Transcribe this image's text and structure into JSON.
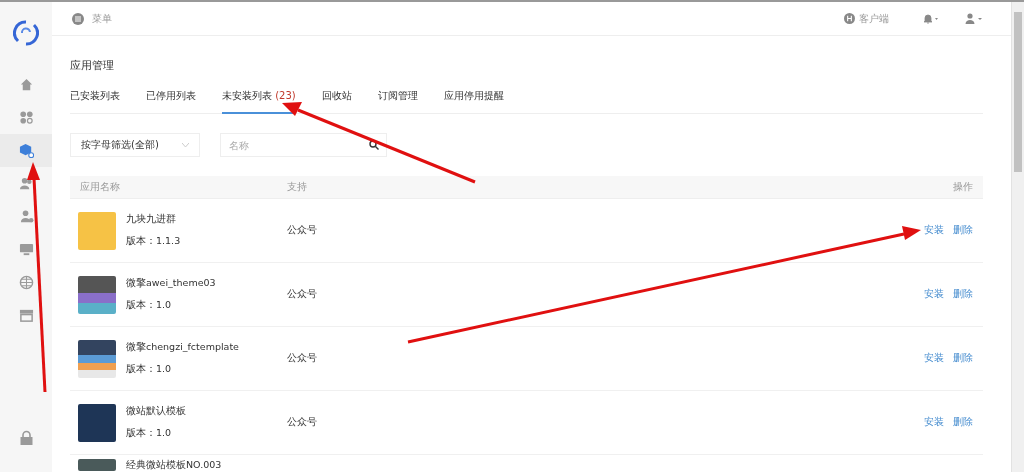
{
  "sidebar": {
    "items": [
      {
        "selected": false
      },
      {
        "selected": false
      },
      {
        "selected": true
      },
      {
        "selected": false
      },
      {
        "selected": false
      },
      {
        "selected": false
      },
      {
        "selected": false
      },
      {
        "selected": false
      }
    ]
  },
  "topbar": {
    "menu_label": "菜单",
    "client_label": "客户端"
  },
  "page_title": "应用管理",
  "tabs": [
    {
      "label": "已安装列表",
      "selected": false
    },
    {
      "label": "已停用列表",
      "selected": false
    },
    {
      "label": "未安装列表",
      "count": "(23)",
      "selected": true
    },
    {
      "label": "回收站",
      "selected": false
    },
    {
      "label": "订阅管理",
      "selected": false
    },
    {
      "label": "应用停用提醒",
      "selected": false
    }
  ],
  "filters": {
    "letter_select": "按字母筛选(全部)",
    "search": {
      "placeholder": "名称"
    }
  },
  "table": {
    "columns": [
      "应用名称",
      "支持",
      "操作"
    ],
    "rows": [
      {
        "name": "九块九进群",
        "version": "版本：1.1.3",
        "support": "公众号",
        "actions": [
          "安装",
          "删除"
        ]
      },
      {
        "name": "微擎awei_theme03",
        "version": "版本：1.0",
        "support": "公众号",
        "actions": [
          "安装",
          "删除"
        ]
      },
      {
        "name": "微擎chengzi_fctemplate",
        "version": "版本：1.0",
        "support": "公众号",
        "actions": [
          "安装",
          "删除"
        ]
      },
      {
        "name": "微站默认模板",
        "version": "版本：1.0",
        "support": "公众号",
        "actions": [
          "安装",
          "删除"
        ]
      },
      {
        "name": "经典微站模板NO.003"
      }
    ]
  }
}
